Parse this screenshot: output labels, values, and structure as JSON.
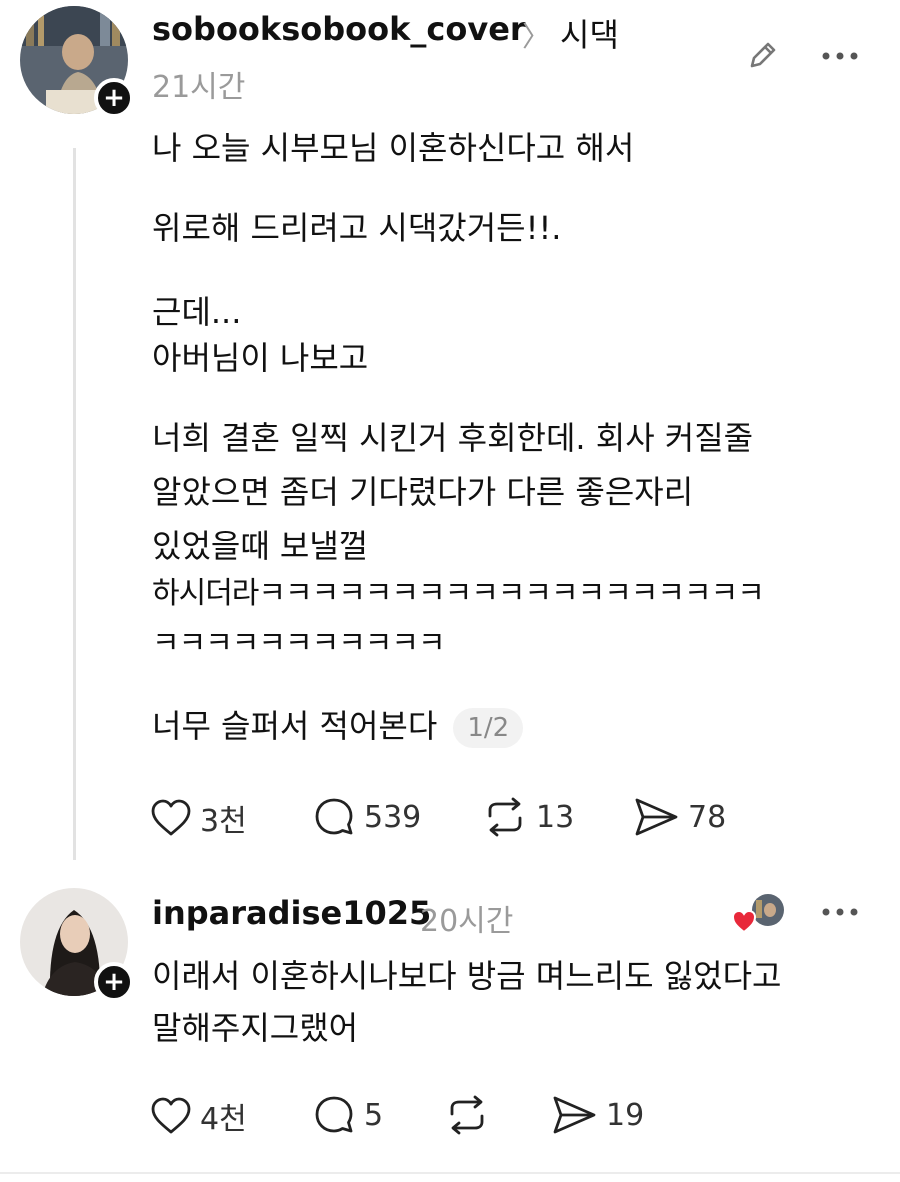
{
  "post": {
    "username": "sobooksobook_cover",
    "topic": "시댁",
    "time": "21시간",
    "lines": [
      "나 오늘 시부모님 이혼하신다고 해서",
      "위로해 드리려고 시댁갔거든!!.",
      "근데...",
      "아버님이 나보고",
      "너희 결혼 일찍 시킨거 후회한데. 회사 커질줄",
      "알았으면 좀더 기다렸다가 다른 좋은자리",
      "있었을때 보낼껄",
      "하시더라ㅋㅋㅋㅋㅋㅋㅋㅋㅋㅋㅋㅋㅋㅋㅋㅋㅋㅋㅋ",
      "ㅋㅋㅋㅋㅋㅋㅋㅋㅋㅋㅋ",
      "너무 슬퍼서 적어본다"
    ],
    "page_indicator": "1/2",
    "likes": "3천",
    "comments": "539",
    "reposts": "13",
    "shares": "78"
  },
  "reply": {
    "username": "inparadise1025",
    "time": "20시간",
    "lines": [
      "이래서 이혼하시나보다 방금 며느리도 잃었다고",
      "말해주지그랬어"
    ],
    "likes": "4천",
    "comments": "5",
    "reposts": "",
    "shares": "19"
  },
  "colors": {
    "text": "#111111",
    "muted": "#9a9a9a",
    "heart_red": "#e8283a"
  },
  "icons": [
    "edit-icon",
    "more-icon",
    "heart-icon",
    "comment-icon",
    "repost-icon",
    "share-icon",
    "follow-plus-icon"
  ]
}
